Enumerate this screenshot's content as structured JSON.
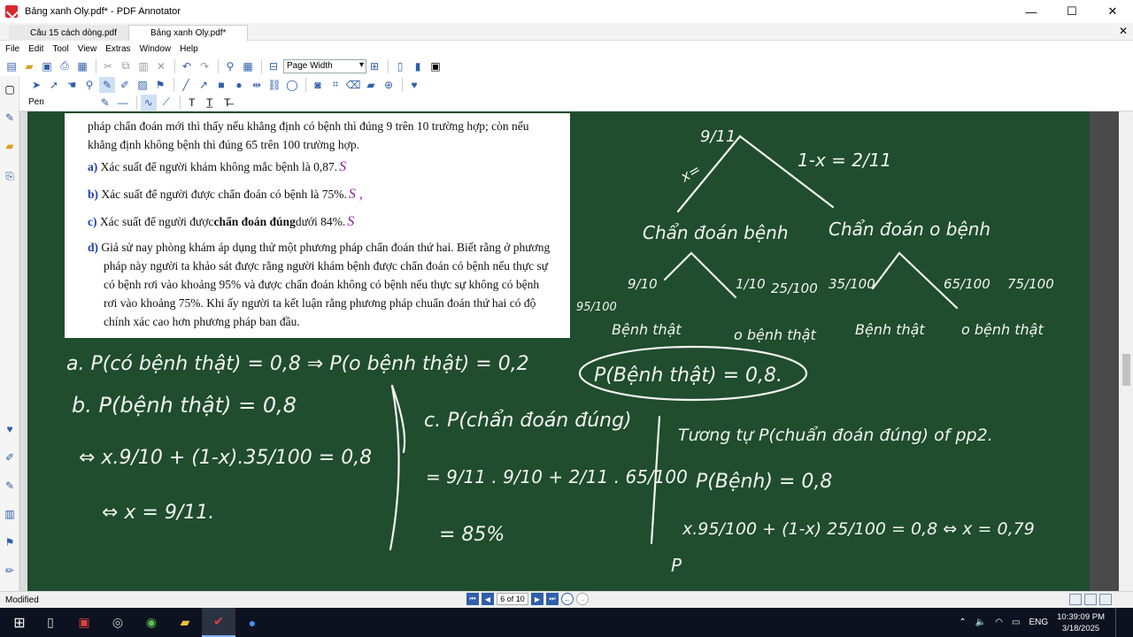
{
  "window": {
    "title": "Bảng xanh Oly.pdf* - PDF Annotator",
    "controls": [
      "—",
      "☐",
      "✕"
    ]
  },
  "tabs": [
    {
      "label": "Câu 15 cách dòng.pdf"
    },
    {
      "label": "Bảng xanh Oly.pdf*"
    }
  ],
  "menu": [
    "File",
    "Edit",
    "Tool",
    "View",
    "Extras",
    "Window",
    "Help"
  ],
  "toolbar": {
    "zoom_mode": "Page Width",
    "pen_label": "Pen"
  },
  "document": {
    "intro_line1": "pháp chẩn đoán mới thì thấy nếu khẳng định có bệnh thì đúng 9 trên 10 trường hợp; còn nếu",
    "intro_line2": "khẳng định không bệnh thì đúng 65 trên 100 trường hợp.",
    "options": [
      {
        "letter": "a)",
        "text": "Xác suất để người khám không mắc bệnh là 0,87."
      },
      {
        "letter": "b)",
        "text": "Xác suất để người được chẩn đoán có bệnh là 75%."
      },
      {
        "letter": "c)",
        "text_before": "Xác suất để người được ",
        "bold": "chẩn đoán đúng",
        "text_after": " dưới 84%."
      },
      {
        "letter": "d)",
        "text": "Giả sử nay phòng khám áp dụng thử một phương pháp chẩn đoán thứ hai. Biết rằng ở phương pháp này người ta khảo sát được rằng người khám bệnh được chẩn đoán có bệnh nếu thực sự có bệnh rơi vào khoảng 95% và được chẩn đoán không có bệnh nếu thực sự không có bệnh rơi vào khoảng 75%. Khi ấy người ta kết luận rằng phương pháp chuẩn đoán thứ hai có độ chính xác cao hơn phương pháp ban đầu."
      }
    ],
    "marks": [
      "S",
      "S ,",
      "S"
    ]
  },
  "handwriting": {
    "tree_top_left": "9/11",
    "x_label": "x=",
    "tree_top_right": "1-x = 2/11",
    "node_left": "Chẩn đoán bệnh",
    "node_right": "Chẩn đoán o bệnh",
    "branch_vals": [
      "9/10",
      "1/10",
      "25/100",
      "35/100",
      "65/100",
      "75/100"
    ],
    "leaf_labels": [
      "Bệnh thật",
      "o bệnh thật",
      "Bệnh thật",
      "o bệnh thật"
    ],
    "side_val": "95/100",
    "circled": "P(Bệnh thật) = 0,8.",
    "line_a": "a. P(có bệnh thật) = 0,8 ⇒ P(o bệnh thật) = 0,2",
    "line_b": "b. P(bệnh thật) = 0,8",
    "line_b2": "⇔ x.9/10 + (1-x).35/100 = 0,8",
    "line_b3": "⇔ x = 9/11.",
    "line_c": "c. P(chẩn đoán đúng)",
    "line_c2": "= 9/11 . 9/10 + 2/11 . 65/100",
    "line_c3": "= 85%",
    "line_d": "Tương tự P(chuẩn đoán đúng) of pp2.",
    "line_d2": "P(Bệnh) = 0,8",
    "line_d3": "x.95/100 + (1-x) 25/100 = 0,8 ⇔ x = 0,79",
    "line_d4": "P"
  },
  "status": {
    "text": "Modified",
    "page": "6 of 10"
  },
  "taskbar": {
    "lang": "ENG",
    "time": "10:39:09 PM",
    "date": "3/18/2025"
  }
}
